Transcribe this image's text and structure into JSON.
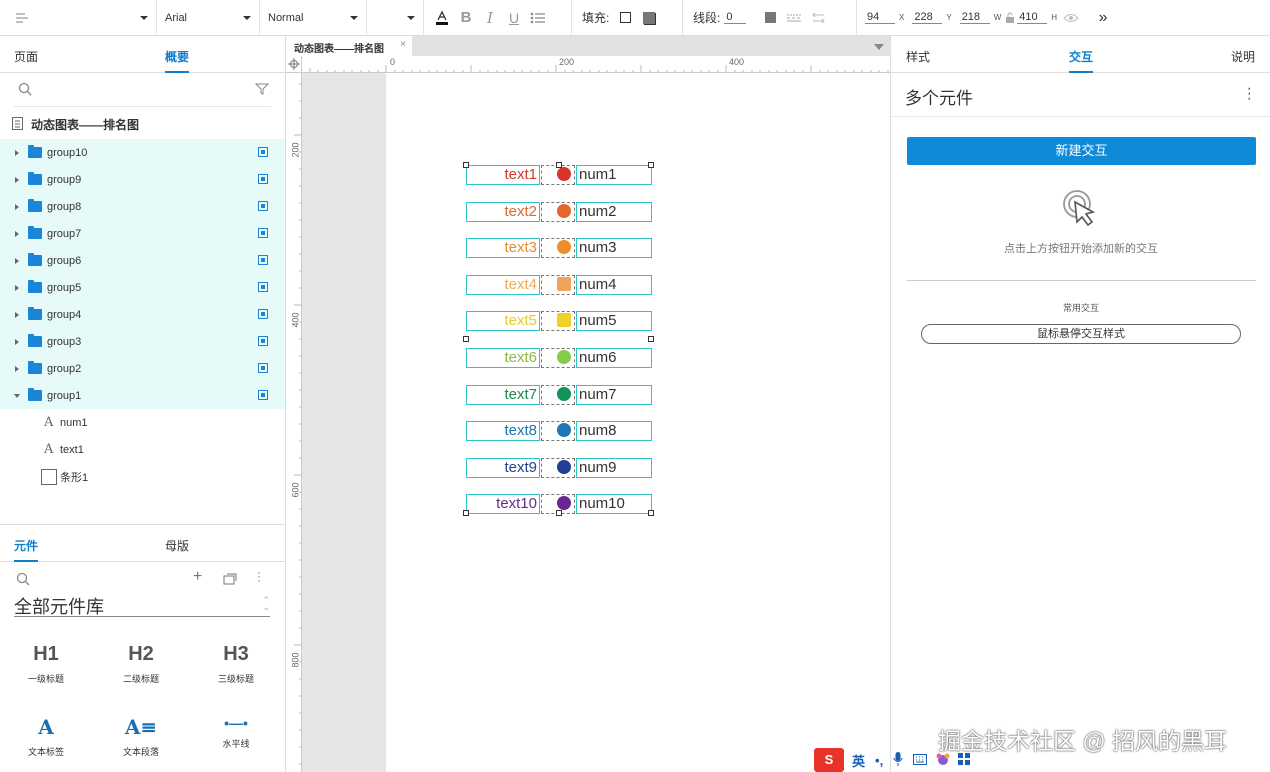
{
  "toolbar": {
    "font": "Arial",
    "style": "Normal",
    "fill_label": "填充:",
    "stroke_label": "线段:",
    "stroke_value": "0",
    "x": "94",
    "x_unit": "X",
    "y": "228",
    "y_unit": "Y",
    "w": "218",
    "w_unit": "W",
    "h": "410",
    "h_unit": "H",
    "icons": [
      "paint-format-icon",
      "font-color-icon",
      "bold-icon",
      "italic-icon",
      "underline-icon",
      "list-icon",
      "fill-box-icon",
      "fill-shadow-icon",
      "stroke-color-icon",
      "stroke-pattern-icon",
      "arrow-style-icon",
      "lock-icon",
      "eye-icon",
      "chevron-double-right-icon"
    ]
  },
  "left": {
    "tabs": [
      "页面",
      "概要"
    ],
    "active_tab": "概要",
    "page_title": "动态图表——排名图",
    "groups": [
      "group10",
      "group9",
      "group8",
      "group7",
      "group6",
      "group5",
      "group4",
      "group3",
      "group2",
      "group1"
    ],
    "children": [
      {
        "icon": "A",
        "label": "num1"
      },
      {
        "icon": "A",
        "label": "text1"
      },
      {
        "icon": "box",
        "label": "条形1"
      }
    ]
  },
  "library": {
    "tabs": [
      "元件",
      "母版"
    ],
    "active_tab": "元件",
    "title": "全部元件库",
    "widgets": [
      {
        "glyph": "H1",
        "label": "一级标题"
      },
      {
        "glyph": "H2",
        "label": "二级标题"
      },
      {
        "glyph": "H3",
        "label": "三级标题"
      },
      {
        "glyph": "A",
        "label": "文本标签"
      },
      {
        "glyph": "A≡",
        "label": "文本段落"
      },
      {
        "glyph": "•—•",
        "label": "水平线"
      }
    ]
  },
  "canvas": {
    "doc_tab": "动态图表——排名图",
    "ruler_top": [
      "0",
      "200",
      "400"
    ],
    "ruler_left": [
      "200",
      "400",
      "600",
      "800"
    ],
    "rows": [
      {
        "text": "text1",
        "num": "num1",
        "text_color": "#d43a2a",
        "dot": "#d9342b",
        "shape": "circle"
      },
      {
        "text": "text2",
        "num": "num2",
        "text_color": "#d96a32",
        "dot": "#e2672c",
        "shape": "circle"
      },
      {
        "text": "text3",
        "num": "num3",
        "text_color": "#e0902f",
        "dot": "#ec8f2a",
        "shape": "circle"
      },
      {
        "text": "text4",
        "num": "num4",
        "text_color": "#f2a95a",
        "dot": "#f0a45a",
        "shape": "square"
      },
      {
        "text": "text5",
        "num": "num5",
        "text_color": "#e6cc2e",
        "dot": "#ecd22a",
        "shape": "square"
      },
      {
        "text": "text6",
        "num": "num6",
        "text_color": "#8bbb3a",
        "dot": "#84cc4a",
        "shape": "circle"
      },
      {
        "text": "text7",
        "num": "num7",
        "text_color": "#1f8a54",
        "dot": "#13935a",
        "shape": "circle"
      },
      {
        "text": "text8",
        "num": "num8",
        "text_color": "#1c77a8",
        "dot": "#1b78b5",
        "shape": "circle"
      },
      {
        "text": "text9",
        "num": "num9",
        "text_color": "#22448a",
        "dot": "#233f95",
        "shape": "circle"
      },
      {
        "text": "text10",
        "num": "num10",
        "text_color": "#6a2a8a",
        "dot": "#6a2690",
        "shape": "circle"
      }
    ]
  },
  "right": {
    "tabs": [
      "样式",
      "交互",
      "说明"
    ],
    "active_tab": "交互",
    "heading": "多个元件",
    "new_button": "新建交互",
    "hint": "点击上方按钮开始添加新的交互",
    "common_label": "常用交互",
    "hover_button": "鼠标悬停交互样式"
  },
  "watermark": "掘金技术社区 @ 招风的黑耳",
  "ime": {
    "label": "英",
    "punct": "•,"
  }
}
